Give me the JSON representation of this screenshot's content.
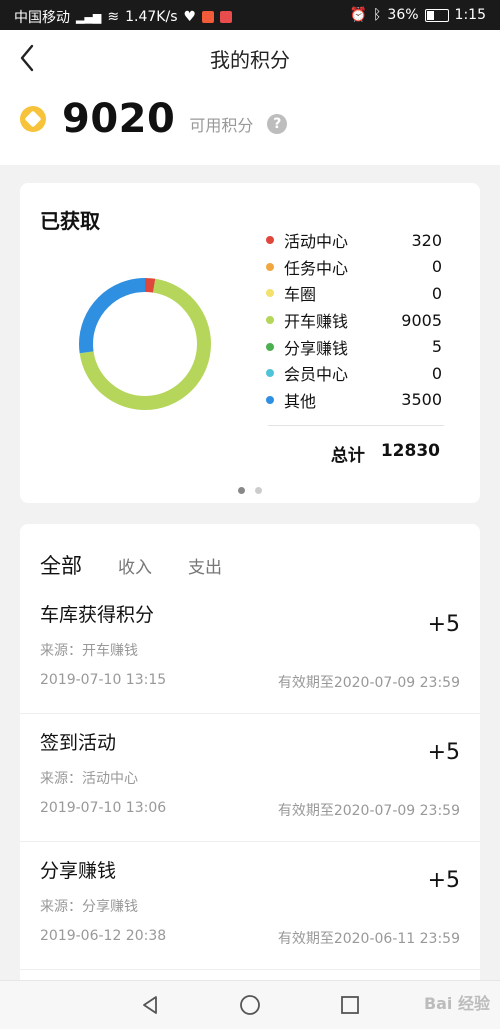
{
  "status_bar": {
    "carrier": "中国移动",
    "network_speed": "1.47K/s",
    "battery": "36%",
    "time": "1:15"
  },
  "header": {
    "title": "我的积分",
    "points": "9020",
    "points_label": "可用积分",
    "help_symbol": "?"
  },
  "earned_card": {
    "title": "已获取",
    "legend": [
      {
        "name": "活动中心",
        "value": "320",
        "color": "#e0473b"
      },
      {
        "name": "任务中心",
        "value": "0",
        "color": "#f0a742"
      },
      {
        "name": "车圈",
        "value": "0",
        "color": "#f4e06d"
      },
      {
        "name": "开车赚钱",
        "value": "9005",
        "color": "#b5d65a"
      },
      {
        "name": "分享赚钱",
        "value": "5",
        "color": "#4caf50"
      },
      {
        "name": "会员中心",
        "value": "0",
        "color": "#4fc3d7"
      },
      {
        "name": "其他",
        "value": "3500",
        "color": "#2f8fe0"
      }
    ],
    "total_label": "总计",
    "total_value": "12830",
    "pager": {
      "count": 2,
      "active": 0
    }
  },
  "history": {
    "tabs": [
      "全部",
      "收入",
      "支出"
    ],
    "active_tab": 0,
    "records": [
      {
        "title": "车库获得积分",
        "source": "来源：开车赚钱",
        "time": "2019-07-10 13:15",
        "expire": "有效期至2020-07-09 23:59",
        "amount": "+5"
      },
      {
        "title": "签到活动",
        "source": "来源：活动中心",
        "time": "2019-07-10 13:06",
        "expire": "有效期至2020-07-09 23:59",
        "amount": "+5"
      },
      {
        "title": "分享赚钱",
        "source": "来源：分享赚钱",
        "time": "2019-06-12 20:38",
        "expire": "有效期至2020-06-11 23:59",
        "amount": "+5"
      }
    ]
  },
  "icons": {
    "back": "chevron-left-icon",
    "coin": "coin-icon",
    "help": "question-icon",
    "nav_back": "triangle-back-icon",
    "nav_home": "circle-home-icon",
    "nav_recent": "square-recent-icon"
  },
  "watermark": "Bai 经验"
}
